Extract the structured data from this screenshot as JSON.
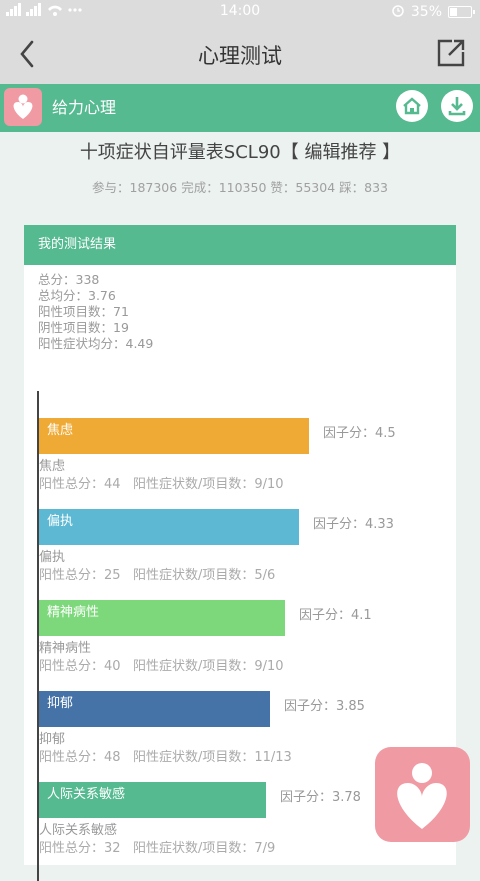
{
  "status": {
    "signal": "   ",
    "time": "14:00",
    "battery": "35%",
    "battery_level": 0.35
  },
  "nav": {
    "title": "心理测试"
  },
  "brand": {
    "name": "给力心理"
  },
  "test": {
    "title": "十项症状自评量表SCL90【 编辑推荐 】",
    "stats": "参与：187306 完成：110350 赞：55304 踩：833"
  },
  "result": {
    "header": "我的测试结果",
    "summary": [
      "总分：338",
      "总均分：3.76",
      "阳性项目数：71",
      "阴性项目数：19",
      "阳性症状均分：4.49"
    ]
  },
  "chart_data": {
    "type": "bar",
    "orientation": "horizontal",
    "categories": [
      "焦虑",
      "偏执",
      "精神病性",
      "抑郁",
      "人际关系敏感"
    ],
    "values": [
      4.5,
      4.33,
      4.1,
      3.85,
      3.78
    ],
    "colors": [
      "#eeaa35",
      "#5cb8d3",
      "#7dd87b",
      "#4572a7",
      "#56ba91"
    ],
    "factor_prefix": "因子分：",
    "factor_labels": [
      "因子分：4.5",
      "因子分：4.33",
      "因子分：4.1",
      "因子分：3.85",
      "因子分：3.78"
    ],
    "details": [
      "阳性总分：44   阳性症状数/项目数：9/10",
      "阳性总分：25   阳性症状数/项目数：5/6",
      "阳性总分：40   阳性症状数/项目数：9/10",
      "阳性总分：48   阳性症状数/项目数：11/13",
      "阳性总分：32   阳性症状数/项目数：7/9"
    ],
    "xlim": [
      0,
      5
    ]
  }
}
